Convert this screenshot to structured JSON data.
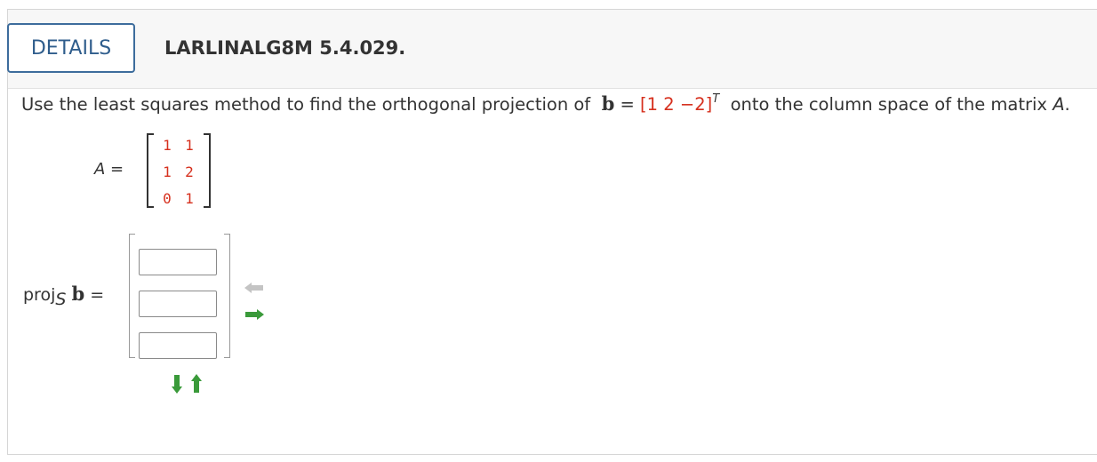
{
  "header": {
    "details_label": "DETAILS",
    "question_id": "LARLINALG8M 5.4.029."
  },
  "question": {
    "prefix": "Use the least squares method to find the orthogonal projection of",
    "vector_name": "b",
    "equals": "=",
    "vector_value": "[1 2 −2]",
    "transpose": "T",
    "suffix": "onto the column space of the matrix",
    "matrix_name": "A",
    "period": "."
  },
  "matrix_a": {
    "label": "A =",
    "rows": [
      [
        "1",
        "1"
      ],
      [
        "1",
        "2"
      ],
      [
        "0",
        "1"
      ]
    ]
  },
  "answer": {
    "label_proj": "proj",
    "label_sub": "S",
    "label_b": "b",
    "label_eq": "=",
    "inputs": [
      "",
      "",
      ""
    ]
  },
  "colors": {
    "accent": "#3d6c9c",
    "highlight_red": "#d6301e",
    "arrow_green": "#3a9a3a",
    "arrow_gray": "#b8b8b8"
  }
}
